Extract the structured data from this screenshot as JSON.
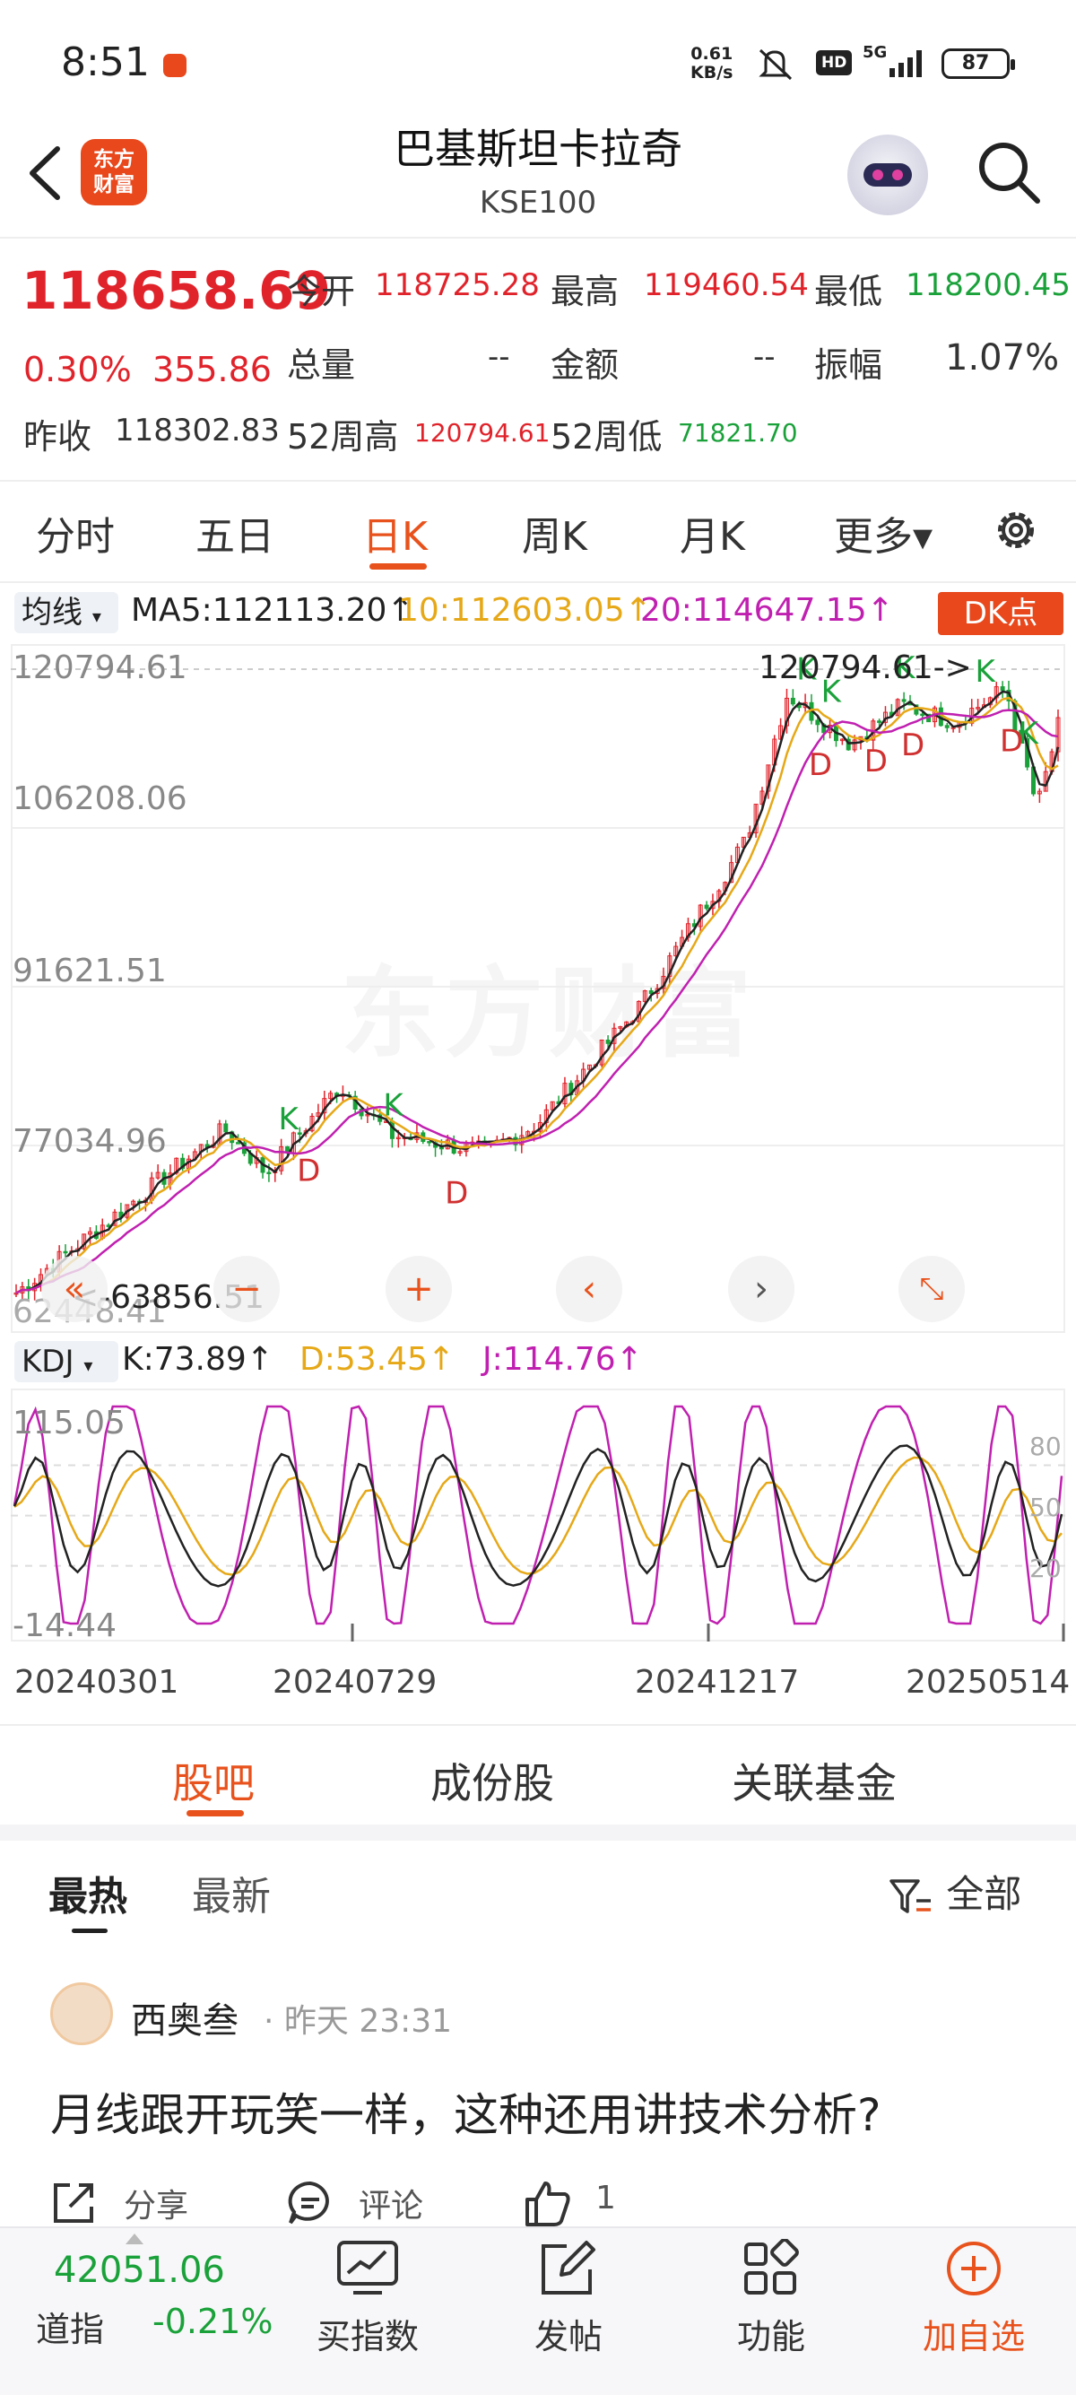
{
  "status": {
    "time": "8:51",
    "net_speed_value": "0.61",
    "net_speed_unit": "KB/s",
    "hd": "HD",
    "network": "5G",
    "battery": "87"
  },
  "header": {
    "logo_line1": "东方",
    "logo_line2": "财富",
    "title": "巴基斯坦卡拉奇",
    "code": "KSE100"
  },
  "quote": {
    "price": "118658.69",
    "change_pct": "0.30%",
    "change_abs": "355.86",
    "open_label": "今开",
    "open": "118725.28",
    "high_label": "最高",
    "high": "119460.54",
    "low_label": "最低",
    "low": "118200.45",
    "volume_label": "总量",
    "volume": "--",
    "amount_label": "金额",
    "amount": "--",
    "amplitude_label": "振幅",
    "amplitude": "1.07%",
    "prev_close_label": "昨收",
    "prev_close": "118302.83",
    "w52_high_label": "52周高",
    "w52_high": "120794.61",
    "w52_low_label": "52周低",
    "w52_low": "71821.70"
  },
  "tabs": [
    "分时",
    "五日",
    "日K",
    "周K",
    "月K",
    "更多▾"
  ],
  "indicators": {
    "ma_button": "均线",
    "ma5": "MA5:112113.20↑",
    "ma10": "10:112603.05↑",
    "ma20": "20:114647.15↑",
    "dk_button": "DK点",
    "kdj_button": "KDJ",
    "k": "K:73.89↑",
    "d": "D:53.45↑",
    "j": "J:114.76↑"
  },
  "chart_data": {
    "type": "candlestick",
    "y_labels": [
      "120794.61",
      "106208.06",
      "91621.51",
      "77034.96",
      "62448.41"
    ],
    "ylim": [
      62448.41,
      120794.61
    ],
    "max_annotation": "120794.61->",
    "min_annotation": "<-63856.51",
    "dates": [
      "20240301",
      "20240729",
      "20241217",
      "20250514"
    ],
    "signals": [
      "K",
      "D",
      "K",
      "D",
      "K",
      "K",
      "D",
      "D",
      "K",
      "D",
      "K",
      "K",
      "D"
    ],
    "kdj_labels": [
      "115.05",
      "-14.44",
      "80",
      "50",
      "20"
    ],
    "colors": {
      "ma5": "#222222",
      "ma10": "#e6a817",
      "ma20": "#c020b0",
      "up": "#e0232b",
      "down": "#1aa13a"
    }
  },
  "watermark": "东方财富",
  "sections": {
    "tabs": [
      "股吧",
      "成份股",
      "关联基金"
    ],
    "sub_tabs": [
      "最热",
      "最新"
    ],
    "filter": "全部"
  },
  "post": {
    "user": "西奥叁",
    "time": "· 昨天 23:31",
    "text": "月线跟开玩笑一样，这种还用讲技术分析?",
    "share": "分享",
    "comment": "评论",
    "likes": "1"
  },
  "bottom": {
    "index_value": "42051.06",
    "index_name": "道指",
    "index_change": "-0.21%",
    "items": [
      "买指数",
      "发帖",
      "功能",
      "加自选"
    ]
  }
}
